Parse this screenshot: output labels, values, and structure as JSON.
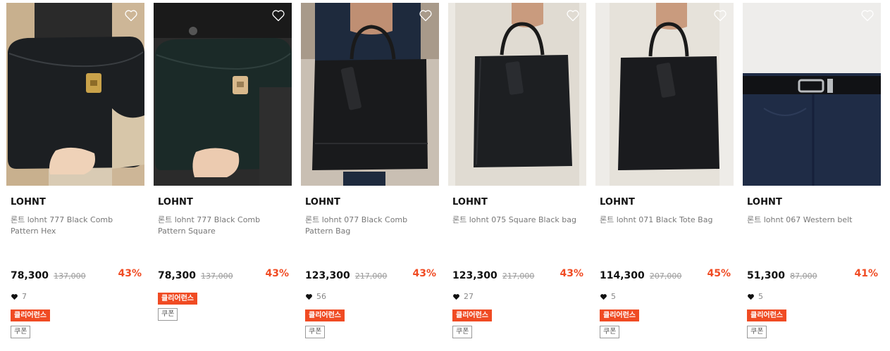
{
  "colors": {
    "accent": "#f04b23",
    "discount": "#f04b23",
    "muted": "#9a9a9a"
  },
  "icons": {
    "wishlist": "heart-outline-icon",
    "likes": "heart-filled-icon"
  },
  "products": [
    {
      "brand": "LOHNT",
      "name": "론트 lohnt 777 Black Comb Pattern Hex",
      "price": "78,300",
      "original_price": "137,000",
      "discount": "43%",
      "likes": "7",
      "badge": "클리어런스",
      "coupon": "쿠폰"
    },
    {
      "brand": "LOHNT",
      "name": "론트 lohnt 777 Black Comb Pattern Square",
      "price": "78,300",
      "original_price": "137,000",
      "discount": "43%",
      "badge": "클리어런스",
      "coupon": "쿠폰"
    },
    {
      "brand": "LOHNT",
      "name": "론트 lohnt 077 Black Comb Pattern Bag",
      "price": "123,300",
      "original_price": "217,000",
      "discount": "43%",
      "likes": "56",
      "badge": "클리어런스",
      "coupon": "쿠폰"
    },
    {
      "brand": "LOHNT",
      "name": "론트 lohnt 075 Square Black bag",
      "price": "123,300",
      "original_price": "217,000",
      "discount": "43%",
      "likes": "27",
      "badge": "클리어런스",
      "coupon": "쿠폰"
    },
    {
      "brand": "LOHNT",
      "name": "론트 lohnt 071 Black Tote Bag",
      "price": "114,300",
      "original_price": "207,000",
      "discount": "45%",
      "likes": "5",
      "badge": "클리어런스",
      "coupon": "쿠폰"
    },
    {
      "brand": "LOHNT",
      "name": "론트 lohnt 067 Western belt",
      "price": "51,300",
      "original_price": "87,000",
      "discount": "41%",
      "likes": "5",
      "badge": "클리어런스",
      "coupon": "쿠폰"
    }
  ]
}
